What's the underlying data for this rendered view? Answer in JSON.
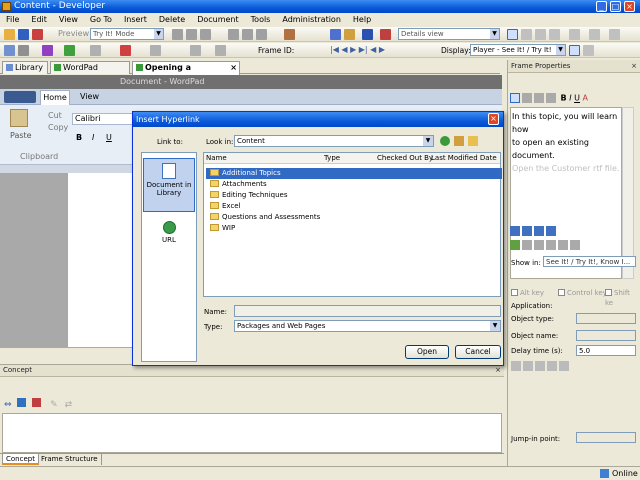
{
  "window": {
    "title": "Content - Developer"
  },
  "menu": [
    "File",
    "Edit",
    "View",
    "Go To",
    "Insert",
    "Delete",
    "Document",
    "Tools",
    "Administration",
    "Help"
  ],
  "toolbar1": {
    "preview_label": "Preview",
    "mode_value": "Try It! Mode",
    "view_value": "Details view"
  },
  "toolbar2": {
    "frame_id_label": "Frame ID:",
    "display_label": "Display:",
    "display_value": "Player - See It! / Try It!"
  },
  "tabs": [
    {
      "label": "Library"
    },
    {
      "label": "WordPad Training"
    },
    {
      "label": "Opening a Document"
    }
  ],
  "wordpad": {
    "title": "Document - WordPad",
    "tab_home": "Home",
    "tab_view": "View",
    "paste": "Paste",
    "cut": "Cut",
    "copy": "Copy",
    "clipboard": "Clipboard",
    "font": "Calibri"
  },
  "concept": {
    "header": "Concept"
  },
  "bottom_tabs": [
    {
      "label": "Concept"
    },
    {
      "label": "Frame Structure"
    }
  ],
  "frame_properties": {
    "header": "Frame Properties",
    "text_line1": "In this topic, you will learn how",
    "text_line2": "to open an existing document.",
    "text_line3": "Open the Customer rtf file.",
    "show_in_label": "Show in:",
    "show_in_value": "See It! / Try It!, Know I...",
    "alt_key": "Alt key",
    "control_key": "Control key",
    "shift_key": "Shift ke",
    "application": "Application:",
    "object_type": "Object type:",
    "object_name": "Object name:",
    "delay_time": "Delay time (s):",
    "delay_value": "5.0",
    "jump_in": "Jump-in point:"
  },
  "dialog": {
    "title": "Insert Hyperlink",
    "link_to_label": "Link to:",
    "look_in_label": "Look in:",
    "look_in_value": "Content",
    "link_options": [
      {
        "label_line1": "Document in",
        "label_line2": "Library"
      },
      {
        "label_line1": "URL",
        "label_line2": ""
      }
    ],
    "columns": [
      "Name",
      "Type",
      "Checked Out By",
      "Last Modified Date"
    ],
    "items": [
      "Additional Topics",
      "Attachments",
      "Editing Techniques",
      "Excel",
      "Questions and Assessments",
      "WIP"
    ],
    "name_label": "Name:",
    "name_value": "",
    "type_label": "Type:",
    "type_value": "Packages and Web Pages",
    "open_button": "Open",
    "cancel_button": "Cancel"
  },
  "status": {
    "text": "Online"
  },
  "colors": {
    "accent": "#316ac5",
    "titlebar": "#0a5ad8",
    "close": "#d8492a"
  }
}
